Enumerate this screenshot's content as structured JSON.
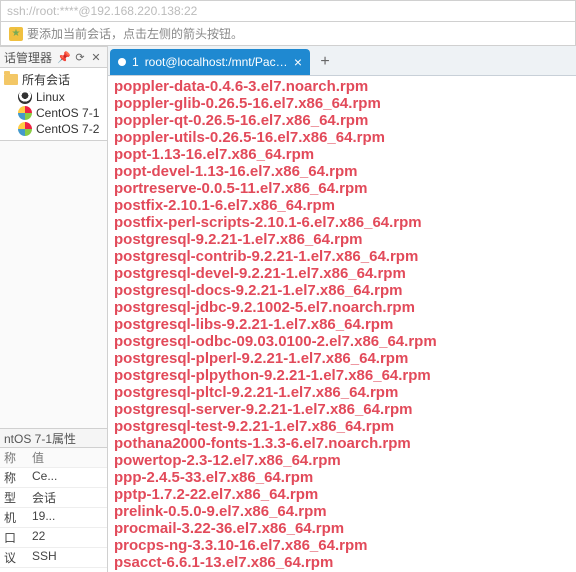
{
  "address_bar": "ssh://root:****@192.168.220.138:22",
  "hint_text": "要添加当前会话，点击左侧的箭头按钮。",
  "sidebar": {
    "title": "话管理器",
    "tree": [
      {
        "icon": "folder",
        "label": "所有会话",
        "indent": 0
      },
      {
        "icon": "linux",
        "label": "Linux",
        "indent": 1
      },
      {
        "icon": "centos",
        "label": "CentOS 7-1",
        "indent": 1
      },
      {
        "icon": "centos",
        "label": "CentOS 7-2",
        "indent": 1
      }
    ],
    "props_title": "ntOS 7-1属性",
    "props_headers": [
      "称",
      "值"
    ],
    "props": [
      [
        "称",
        "Ce..."
      ],
      [
        "型",
        "会话"
      ],
      [
        "机",
        "19..."
      ],
      [
        "口",
        "22"
      ],
      [
        "议",
        "SSH"
      ]
    ]
  },
  "tab": {
    "index": "1",
    "label": "root@localhost:/mnt/Packa..."
  },
  "terminal_lines": [
    "poppler-data-0.4.6-3.el7.noarch.rpm",
    "poppler-glib-0.26.5-16.el7.x86_64.rpm",
    "poppler-qt-0.26.5-16.el7.x86_64.rpm",
    "poppler-utils-0.26.5-16.el7.x86_64.rpm",
    "popt-1.13-16.el7.x86_64.rpm",
    "popt-devel-1.13-16.el7.x86_64.rpm",
    "portreserve-0.0.5-11.el7.x86_64.rpm",
    "postfix-2.10.1-6.el7.x86_64.rpm",
    "postfix-perl-scripts-2.10.1-6.el7.x86_64.rpm",
    "postgresql-9.2.21-1.el7.x86_64.rpm",
    "postgresql-contrib-9.2.21-1.el7.x86_64.rpm",
    "postgresql-devel-9.2.21-1.el7.x86_64.rpm",
    "postgresql-docs-9.2.21-1.el7.x86_64.rpm",
    "postgresql-jdbc-9.2.1002-5.el7.noarch.rpm",
    "postgresql-libs-9.2.21-1.el7.x86_64.rpm",
    "postgresql-odbc-09.03.0100-2.el7.x86_64.rpm",
    "postgresql-plperl-9.2.21-1.el7.x86_64.rpm",
    "postgresql-plpython-9.2.21-1.el7.x86_64.rpm",
    "postgresql-pltcl-9.2.21-1.el7.x86_64.rpm",
    "postgresql-server-9.2.21-1.el7.x86_64.rpm",
    "postgresql-test-9.2.21-1.el7.x86_64.rpm",
    "pothana2000-fonts-1.3.3-6.el7.noarch.rpm",
    "powertop-2.3-12.el7.x86_64.rpm",
    "ppp-2.4.5-33.el7.x86_64.rpm",
    "pptp-1.7.2-22.el7.x86_64.rpm",
    "prelink-0.5.0-9.el7.x86_64.rpm",
    "procmail-3.22-36.el7.x86_64.rpm",
    "procps-ng-3.3.10-16.el7.x86_64.rpm",
    "psacct-6.6.1-13.el7.x86_64.rpm"
  ]
}
